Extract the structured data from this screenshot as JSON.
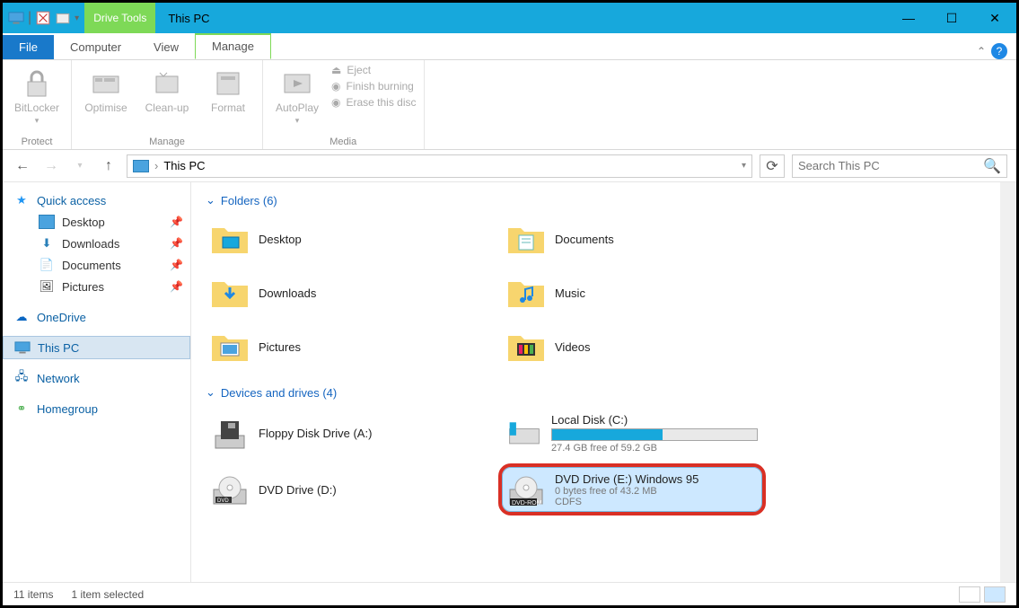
{
  "window": {
    "title": "This PC",
    "driveTools": "Drive Tools"
  },
  "tabs": {
    "file": "File",
    "computer": "Computer",
    "view": "View",
    "manage": "Manage"
  },
  "ribbon": {
    "protect": {
      "bitlocker": "BitLocker",
      "label": "Protect"
    },
    "manage": {
      "optimise": "Optimise",
      "cleanup": "Clean-up",
      "format": "Format",
      "label": "Manage"
    },
    "media": {
      "autoplay": "AutoPlay",
      "eject": "Eject",
      "finish": "Finish burning",
      "erase": "Erase this disc",
      "label": "Media"
    }
  },
  "nav": {
    "location": "This PC",
    "searchPlaceholder": "Search This PC"
  },
  "sidebar": {
    "quick": "Quick access",
    "items": [
      {
        "label": "Desktop"
      },
      {
        "label": "Downloads"
      },
      {
        "label": "Documents"
      },
      {
        "label": "Pictures"
      }
    ],
    "onedrive": "OneDrive",
    "thispc": "This PC",
    "network": "Network",
    "homegroup": "Homegroup"
  },
  "groups": {
    "folders": {
      "header": "Folders (6)",
      "items": [
        "Desktop",
        "Documents",
        "Downloads",
        "Music",
        "Pictures",
        "Videos"
      ]
    },
    "drives": {
      "header": "Devices and drives (4)",
      "floppy": "Floppy Disk Drive (A:)",
      "local": {
        "name": "Local Disk (C:)",
        "free": "27.4 GB free of 59.2 GB"
      },
      "dvdd": "DVD Drive (D:)",
      "dvde": {
        "name": "DVD Drive (E:) Windows 95",
        "free": "0 bytes free of 43.2 MB",
        "fs": "CDFS",
        "badge": "DVD-ROM"
      }
    }
  },
  "status": {
    "count": "11 items",
    "selected": "1 item selected"
  }
}
